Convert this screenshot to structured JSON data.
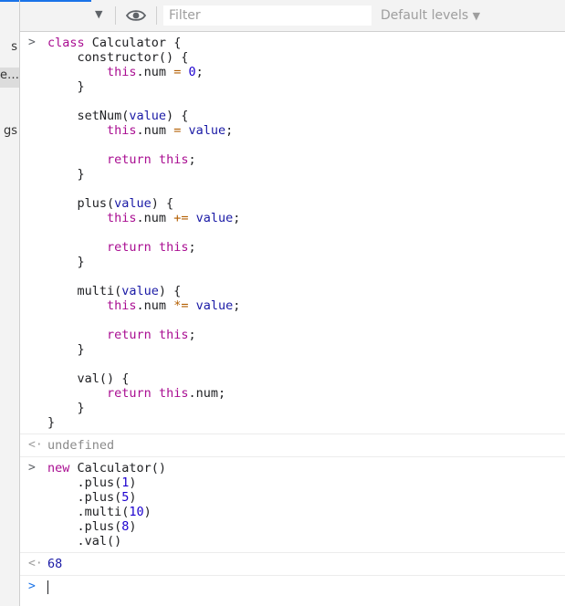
{
  "sidebar": {
    "items": [
      "s",
      "e…",
      "gs"
    ]
  },
  "toolbar": {
    "filter_placeholder": "Filter",
    "levels_label": "Default levels",
    "levels_arrow": "▼",
    "context_arrow": "▼"
  },
  "console": {
    "entries": [
      {
        "type": "input",
        "lines": [
          [
            [
              "kw",
              "class"
            ],
            [
              "t",
              " "
            ],
            [
              "cls",
              "Calculator"
            ],
            [
              "t",
              " {"
            ]
          ],
          [
            [
              "t",
              "    constructor() {"
            ]
          ],
          [
            [
              "t",
              "        "
            ],
            [
              "kw",
              "this"
            ],
            [
              "t",
              ".num "
            ],
            [
              "op",
              "="
            ],
            [
              "t",
              " "
            ],
            [
              "num",
              "0"
            ],
            [
              "t",
              ";"
            ]
          ],
          [
            [
              "t",
              "    }"
            ]
          ],
          [
            [
              "t",
              ""
            ]
          ],
          [
            [
              "t",
              "    setNum("
            ],
            [
              "param",
              "value"
            ],
            [
              "t",
              ") {"
            ]
          ],
          [
            [
              "t",
              "        "
            ],
            [
              "kw",
              "this"
            ],
            [
              "t",
              ".num "
            ],
            [
              "op",
              "="
            ],
            [
              "t",
              " "
            ],
            [
              "param",
              "value"
            ],
            [
              "t",
              ";"
            ]
          ],
          [
            [
              "t",
              ""
            ]
          ],
          [
            [
              "t",
              "        "
            ],
            [
              "kw",
              "return"
            ],
            [
              "t",
              " "
            ],
            [
              "kw",
              "this"
            ],
            [
              "t",
              ";"
            ]
          ],
          [
            [
              "t",
              "    }"
            ]
          ],
          [
            [
              "t",
              ""
            ]
          ],
          [
            [
              "t",
              "    plus("
            ],
            [
              "param",
              "value"
            ],
            [
              "t",
              ") {"
            ]
          ],
          [
            [
              "t",
              "        "
            ],
            [
              "kw",
              "this"
            ],
            [
              "t",
              ".num "
            ],
            [
              "op",
              "+="
            ],
            [
              "t",
              " "
            ],
            [
              "param",
              "value"
            ],
            [
              "t",
              ";"
            ]
          ],
          [
            [
              "t",
              ""
            ]
          ],
          [
            [
              "t",
              "        "
            ],
            [
              "kw",
              "return"
            ],
            [
              "t",
              " "
            ],
            [
              "kw",
              "this"
            ],
            [
              "t",
              ";"
            ]
          ],
          [
            [
              "t",
              "    }"
            ]
          ],
          [
            [
              "t",
              ""
            ]
          ],
          [
            [
              "t",
              "    multi("
            ],
            [
              "param",
              "value"
            ],
            [
              "t",
              ") {"
            ]
          ],
          [
            [
              "t",
              "        "
            ],
            [
              "kw",
              "this"
            ],
            [
              "t",
              ".num "
            ],
            [
              "op",
              "*="
            ],
            [
              "t",
              " "
            ],
            [
              "param",
              "value"
            ],
            [
              "t",
              ";"
            ]
          ],
          [
            [
              "t",
              ""
            ]
          ],
          [
            [
              "t",
              "        "
            ],
            [
              "kw",
              "return"
            ],
            [
              "t",
              " "
            ],
            [
              "kw",
              "this"
            ],
            [
              "t",
              ";"
            ]
          ],
          [
            [
              "t",
              "    }"
            ]
          ],
          [
            [
              "t",
              ""
            ]
          ],
          [
            [
              "t",
              "    val() {"
            ]
          ],
          [
            [
              "t",
              "        "
            ],
            [
              "kw",
              "return"
            ],
            [
              "t",
              " "
            ],
            [
              "kw",
              "this"
            ],
            [
              "t",
              ".num;"
            ]
          ],
          [
            [
              "t",
              "    }"
            ]
          ],
          [
            [
              "t",
              "}"
            ]
          ]
        ]
      },
      {
        "type": "result",
        "lines": [
          [
            [
              "undef",
              "undefined"
            ]
          ]
        ]
      },
      {
        "type": "input",
        "lines": [
          [
            [
              "kw",
              "new"
            ],
            [
              "t",
              " Calculator()"
            ]
          ],
          [
            [
              "t",
              "    .plus("
            ],
            [
              "num",
              "1"
            ],
            [
              "t",
              ")"
            ]
          ],
          [
            [
              "t",
              "    .plus("
            ],
            [
              "num",
              "5"
            ],
            [
              "t",
              ")"
            ]
          ],
          [
            [
              "t",
              "    .multi("
            ],
            [
              "num",
              "10"
            ],
            [
              "t",
              ")"
            ]
          ],
          [
            [
              "t",
              "    .plus("
            ],
            [
              "num",
              "8"
            ],
            [
              "t",
              ")"
            ]
          ],
          [
            [
              "t",
              "    .val()"
            ]
          ]
        ]
      },
      {
        "type": "result",
        "lines": [
          [
            [
              "numres",
              "68"
            ]
          ]
        ]
      }
    ]
  },
  "colors": {
    "keyword": "#a90d91",
    "number": "#1c00cf",
    "operator": "#b35e00",
    "param": "#1a1aa6",
    "accent": "#1a73e8"
  },
  "icons": {
    "prompt_input": ">",
    "prompt_result": "<·",
    "eye": "eye-icon"
  }
}
